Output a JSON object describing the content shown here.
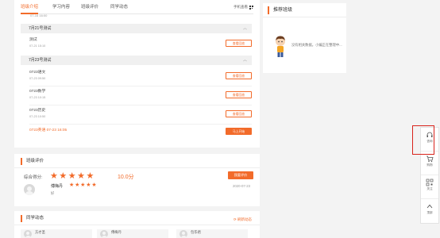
{
  "colors": {
    "accent": "#f26b2a",
    "highlight": "#d9231b"
  },
  "tabs": [
    {
      "label": "班级介绍",
      "active": true
    },
    {
      "label": "学习内容",
      "active": false
    },
    {
      "label": "班级评价",
      "active": false
    },
    {
      "label": "同学动态",
      "active": false
    }
  ],
  "mobile_view": {
    "label": "手机查看",
    "icon": "qr-code-icon"
  },
  "cut_off_date": "07-16 16:00",
  "groups": [
    {
      "title": "7月21号测试",
      "items": [
        {
          "name": "测试",
          "date": "07-21 15:10",
          "action": "查看回放"
        }
      ]
    },
    {
      "title": "7月23号测试",
      "items": [
        {
          "name": "0723语文",
          "date": "07-23 09:50",
          "action": "查看回放"
        },
        {
          "name": "0723数学",
          "date": "07-23 10:15",
          "action": "查看回放"
        },
        {
          "name": "0723历史",
          "date": "07-23 10:50",
          "action": "查看回放"
        }
      ],
      "live": {
        "text": "0723英语 07-23 16:05",
        "action": "马上开始"
      }
    }
  ],
  "recommend": {
    "title": "推荐班级",
    "empty_message": "没有相关数据。小编正在整理中..."
  },
  "evaluation": {
    "title": "班级评价",
    "score_label": "综合得分:",
    "stars": 5,
    "score": "10.0分",
    "button": "我要评价",
    "review": {
      "name": "傅梅丹",
      "stars": 5,
      "date": "2020-07-23",
      "text": "好"
    }
  },
  "classmates": {
    "title": "同学动态",
    "refresh": "刷新动态",
    "people": [
      "方才圣",
      "傅梅丹",
      "包华君"
    ]
  },
  "side_bar": [
    {
      "label": "咨询",
      "icon": "headset-icon"
    },
    {
      "label": "购物",
      "icon": "cart-icon"
    },
    {
      "label": "关注",
      "icon": "qr-code-icon"
    },
    {
      "label": "顶部",
      "icon": "back-to-top-icon"
    }
  ]
}
